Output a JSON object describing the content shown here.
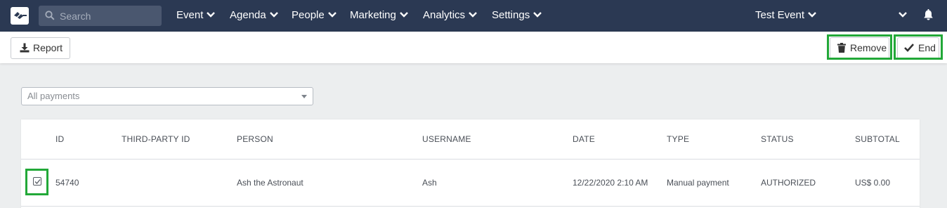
{
  "nav": {
    "search_placeholder": "Search",
    "menu": [
      "Event",
      "Agenda",
      "People",
      "Marketing",
      "Analytics",
      "Settings"
    ],
    "event_selector": "Test Event"
  },
  "toolbar": {
    "report_label": "Report",
    "remove_label": "Remove",
    "end_label": "End"
  },
  "filter": {
    "selected": "All payments"
  },
  "table": {
    "columns": [
      "ID",
      "THIRD-PARTY ID",
      "PERSON",
      "USERNAME",
      "DATE",
      "TYPE",
      "STATUS",
      "SUBTOTAL"
    ],
    "rows": [
      {
        "id": "54740",
        "third_party_id": "",
        "person": "Ash the Astronaut",
        "username": "Ash",
        "date": "12/22/2020 2:10 AM",
        "type": "Manual payment",
        "status": "AUTHORIZED",
        "subtotal": "US$ 0.00",
        "selected": true
      }
    ]
  },
  "colors": {
    "nav_bg": "#2b3953",
    "highlight": "#22a838",
    "page_bg": "#eceeef"
  }
}
